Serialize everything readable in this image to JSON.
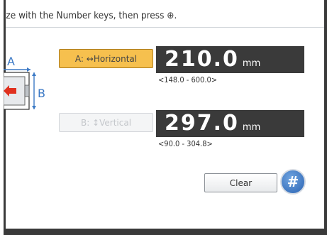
{
  "instruction": {
    "text": "ize with the Number keys, then press ⊕."
  },
  "diagram": {
    "label_a": "A",
    "label_b": "B"
  },
  "horizontal": {
    "button_label": "A: ↔Horizontal",
    "value": "210.0",
    "unit": "mm",
    "range": "<148.0 - 600.0>"
  },
  "vertical": {
    "button_label": "B: ↕Vertical",
    "value": "297.0",
    "unit": "mm",
    "range": "<90.0 - 304.8>"
  },
  "actions": {
    "clear_label": "Clear",
    "enter_label": "#"
  },
  "colors": {
    "selected_button": "#f6c04e",
    "value_box": "#3a3a3a",
    "enter_button": "#2a63b3"
  },
  "icons": {
    "diagram": "paper-size-diagram-icon",
    "enter": "hash-enter-icon"
  }
}
